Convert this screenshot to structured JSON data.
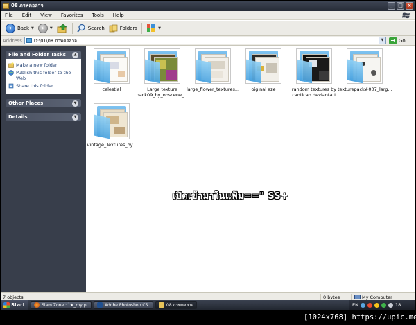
{
  "window": {
    "title": "08 ภาพคอลาจ",
    "buttons": [
      "_",
      "□",
      "×"
    ]
  },
  "menu": [
    "File",
    "Edit",
    "View",
    "Favorites",
    "Tools",
    "Help"
  ],
  "toolbar": {
    "back_label": "Back",
    "search_label": "Search",
    "folders_label": "Folders"
  },
  "address": {
    "label": "Address",
    "value": "D:\\01\\08 ภาพคอลาจ",
    "go_label": "Go"
  },
  "left_pane": {
    "file_folder_tasks": {
      "title": "File and Folder Tasks",
      "items": [
        "Make a new folder",
        "Publish this folder to the Web",
        "Share this folder"
      ]
    },
    "other_places": {
      "title": "Other Places"
    },
    "details": {
      "title": "Details"
    }
  },
  "folders": [
    {
      "label": "celestial"
    },
    {
      "label": "Large texture pack09_by_obscene_..."
    },
    {
      "label": "large_flower_textures..."
    },
    {
      "label": "oiginal aze"
    },
    {
      "label": "random textures by caoticah deviantart"
    },
    {
      "label": "texturepack#007_larg..."
    },
    {
      "label": "Vintage_Textures_by..."
    }
  ],
  "overlay": {
    "text": "เปิดเข้ามาในแฟ้ม==\" SS+"
  },
  "status": {
    "objects": "7 objects",
    "size": "0 bytes",
    "location": "My Computer"
  },
  "taskbar": {
    "start_label": "Start",
    "tasks": [
      {
        "label": "Siam Zone : `★_my p..."
      },
      {
        "label": "Adobe Photoshop CS..."
      },
      {
        "label": "08 ภาพคอลาจ"
      }
    ],
    "tray": {
      "lang": "EN",
      "clock": "18 ..."
    }
  },
  "watermark": {
    "text": "[1024x768] https://upic.me/"
  }
}
